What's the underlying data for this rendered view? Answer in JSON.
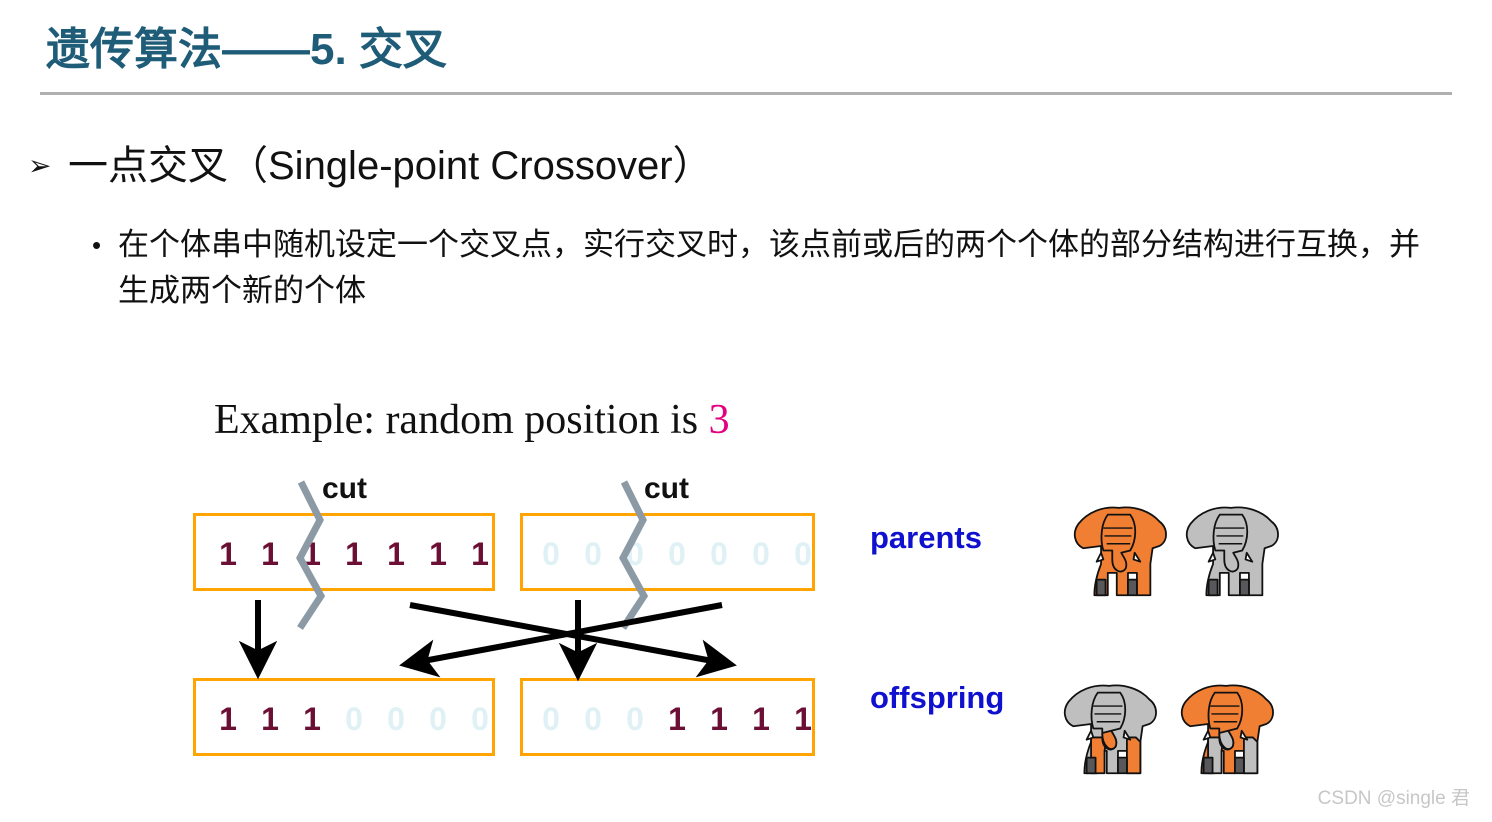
{
  "slide": {
    "title": "遗传算法——5. 交叉",
    "title_color": "#1F5C78"
  },
  "bullets": {
    "level1_marker": "➢",
    "level1_text": "一点交叉（Single-point Crossover）",
    "level2_marker": "•",
    "level2_text": "在个体串中随机设定一个交叉点，实行交叉时，该点前或后的两个个体的部分结构进行互换，并生成两个新的个体"
  },
  "example": {
    "caption_prefix": "Example: random position is ",
    "position_value": "3",
    "position_color": "#E4007F"
  },
  "diagram": {
    "cut_label_left": "cut",
    "cut_label_right": "cut",
    "parents_label": "parents",
    "offspring_label": "offspring",
    "label_color": "#1010CF",
    "box_border_color": "#FFA400",
    "one_color": "#6B0F35",
    "zero_color": "#DFF1F4",
    "cut_line_color": "#8C9AA6",
    "parent_left_bits": [
      "1",
      "1",
      "1",
      "1",
      "1",
      "1",
      "1"
    ],
    "parent_right_bits": [
      "0",
      "0",
      "0",
      "0",
      "0",
      "0",
      "0"
    ],
    "offspring_left_bits": [
      "1",
      "1",
      "1",
      "0",
      "0",
      "0",
      "0"
    ],
    "offspring_right_bits": [
      "0",
      "0",
      "0",
      "1",
      "1",
      "1",
      "1"
    ],
    "crossover_point": 3
  },
  "elephants": {
    "parent_left_color": "#F07F33",
    "parent_right_color": "#BFBFBF",
    "offspring_left_head_color": "#BFBFBF",
    "offspring_left_body_color": "#F07F33",
    "offspring_right_head_color": "#F07F33",
    "offspring_right_body_color": "#BFBFBF",
    "leg_shadow_color": "#58585A"
  },
  "watermark": {
    "text": "CSDN @single 君"
  }
}
